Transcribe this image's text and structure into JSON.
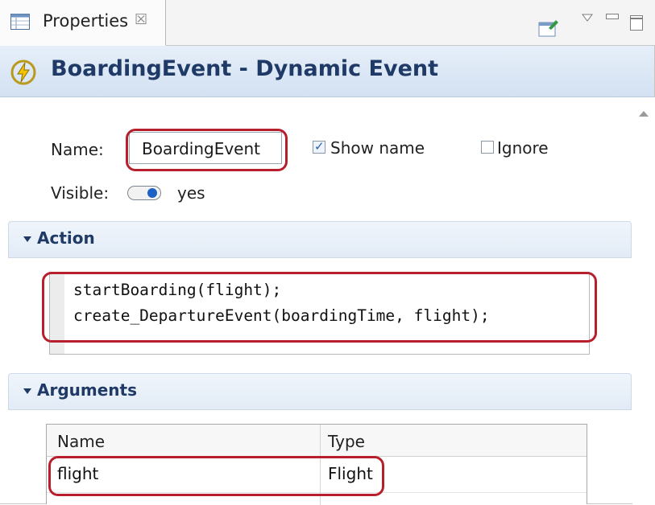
{
  "tab": {
    "label": "Properties",
    "close_glyph": "☒"
  },
  "title": {
    "text": "BoardingEvent - Dynamic Event"
  },
  "general": {
    "name_label": "Name:",
    "name_value": "BoardingEvent",
    "show_name_label": "Show name",
    "show_name_checked": true,
    "ignore_label": "Ignore",
    "ignore_checked": false,
    "visible_label": "Visible:",
    "visible_value": "yes"
  },
  "action": {
    "title": "Action",
    "code_lines": [
      "startBoarding(flight);",
      "create_DepartureEvent(boardingTime, flight);"
    ]
  },
  "arguments": {
    "title": "Arguments",
    "columns": [
      "Name",
      "Type"
    ],
    "rows": [
      {
        "name": "flight",
        "type": "Flight"
      }
    ]
  },
  "colors": {
    "highlight": "#b81f2c",
    "accent": "#1f3a66"
  },
  "icons": [
    "properties-view-icon",
    "lightning-event-icon",
    "pin-view-icon",
    "view-menu-icon",
    "minimize-icon",
    "maximize-icon"
  ]
}
